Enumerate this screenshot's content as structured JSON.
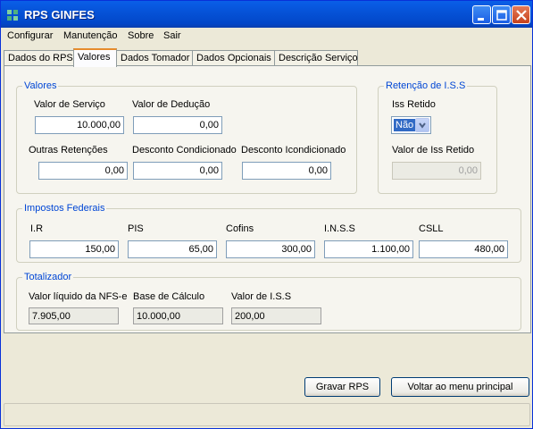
{
  "window": {
    "title": "RPS GINFES"
  },
  "menu": [
    "Configurar",
    "Manutenção",
    "Sobre",
    "Sair"
  ],
  "tabs": [
    "Dados do RPS",
    "Valores",
    "Dados Tomador",
    "Dados  Opcionais",
    "Descrição Serviço"
  ],
  "valores": {
    "legend": "Valores",
    "valor_servico_label": "Valor de Serviço",
    "valor_servico": "10.000,00",
    "valor_deducao_label": "Valor  de Dedução",
    "valor_deducao": "0,00",
    "outras_retencoes_label": "Outras Retenções",
    "outras_retencoes": "0,00",
    "desconto_condicionado_label": "Desconto Condicionado",
    "desconto_condicionado": "0,00",
    "desconto_incondicionado_label": "Desconto Icondicionado",
    "desconto_incondicionado": "0,00"
  },
  "retencao": {
    "legend": "Retenção de I.S.S",
    "iss_retido_label": "Iss Retido",
    "iss_retido_value": "Não",
    "valor_iss_retido_label": "Valor  de Iss Retido",
    "valor_iss_retido": "0,00"
  },
  "impostos": {
    "legend": "Impostos Federais",
    "ir_label": "I.R",
    "ir": "150,00",
    "pis_label": "PIS",
    "pis": "65,00",
    "cofins_label": "Cofins",
    "cofins": "300,00",
    "inss_label": "I.N.S.S",
    "inss": "1.100,00",
    "csll_label": "CSLL",
    "csll": "480,00"
  },
  "totalizador": {
    "legend": "Totalizador",
    "liquido_label": "Valor líquido da  NFS-e",
    "liquido": "7.905,00",
    "base_label": "Base de Cálculo",
    "base": "10.000,00",
    "iss_label": "Valor de I.S.S",
    "iss": "200,00"
  },
  "buttons": {
    "gravar": "Gravar RPS",
    "voltar": "Voltar ao menu principal"
  },
  "colors": {
    "titlebar": "#0653d8",
    "legend": "#0046d5",
    "tab_highlight": "#e68b2c"
  },
  "icons": {
    "app": "app-icon",
    "minimize": "minimize-icon",
    "maximize": "maximize-icon",
    "close": "close-icon"
  }
}
